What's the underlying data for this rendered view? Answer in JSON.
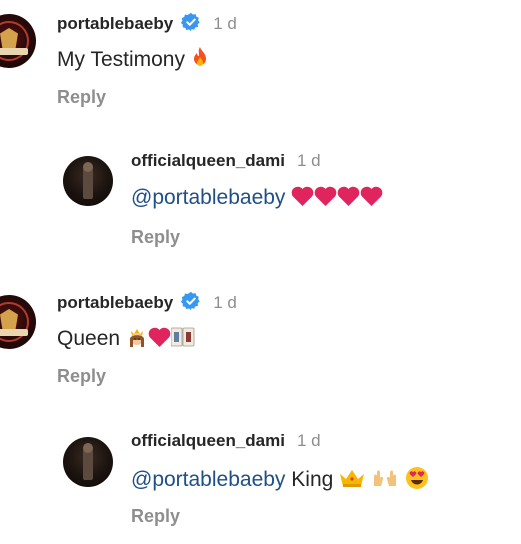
{
  "comments": [
    {
      "username": "portablebaeby",
      "time": "1 d",
      "text": "My Testimony",
      "emoji": [
        "fire"
      ],
      "reply": "Reply",
      "verified": true
    },
    {
      "username": "officialqueen_dami",
      "time": "1 d",
      "mention": "@portablebaeby",
      "text": "",
      "emoji": [
        "red-heart",
        "red-heart",
        "red-heart",
        "red-heart"
      ],
      "reply": "Reply",
      "verified": false
    },
    {
      "username": "portablebaeby",
      "time": "1 d",
      "text": "Queen",
      "emoji": [
        "princess",
        "red-heart",
        "queen-card"
      ],
      "reply": "Reply",
      "verified": true
    },
    {
      "username": "officialqueen_dami",
      "time": "1 d",
      "mention": "@portablebaeby",
      "text": "King",
      "emoji": [
        "crown",
        "raising-hands",
        "heart-eyes"
      ],
      "reply": "Reply",
      "verified": false
    }
  ],
  "colors": {
    "verified": "#3897f0",
    "mention": "#1f4f87",
    "heart": "#e0245e",
    "muted": "#8e8e8e"
  }
}
